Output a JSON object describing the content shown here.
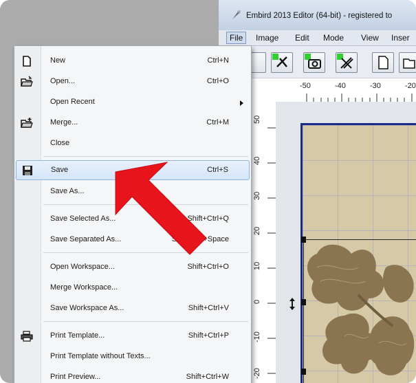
{
  "window": {
    "title": "Embird 2013 Editor (64-bit) - registered to"
  },
  "menubar": {
    "items": [
      "File",
      "Image",
      "Edit",
      "Mode",
      "View",
      "Inser"
    ]
  },
  "ruler": {
    "top_labels": [
      "-50",
      "-40",
      "-30",
      "-20"
    ],
    "left_labels": [
      "50",
      "40",
      "30",
      "20",
      "10",
      "0",
      "-10",
      "-20"
    ]
  },
  "file_menu": {
    "items": [
      {
        "label": "New",
        "shortcut": "Ctrl+N",
        "icon": "new-file-icon"
      },
      {
        "label": "Open...",
        "shortcut": "Ctrl+O",
        "icon": "open-folder-icon"
      },
      {
        "label": "Open Recent",
        "shortcut": "",
        "icon": ""
      },
      {
        "label": "Merge...",
        "shortcut": "Ctrl+M",
        "icon": "merge-folder-icon"
      },
      {
        "label": "Close",
        "shortcut": "",
        "icon": ""
      },
      {
        "label": "Save",
        "shortcut": "Ctrl+S",
        "icon": "floppy-disk-icon"
      },
      {
        "label": "Save As...",
        "shortcut": "",
        "icon": ""
      },
      {
        "label": "Save Selected As...",
        "shortcut": "Shift+Ctrl+Q",
        "icon": ""
      },
      {
        "label": "Save Separated As...",
        "shortcut": "Shift+Ctrl+Space",
        "icon": ""
      },
      {
        "label": "Open Workspace...",
        "shortcut": "Shift+Ctrl+O",
        "icon": ""
      },
      {
        "label": "Merge Workspace...",
        "shortcut": "",
        "icon": ""
      },
      {
        "label": "Save Workspace As...",
        "shortcut": "Shift+Ctrl+V",
        "icon": ""
      },
      {
        "label": "Print Template...",
        "shortcut": "Shift+Ctrl+P",
        "icon": "printer-icon"
      },
      {
        "label": "Print Template without Texts...",
        "shortcut": "",
        "icon": ""
      },
      {
        "label": "Print Preview...",
        "shortcut": "Shift+Ctrl+W",
        "icon": ""
      }
    ]
  },
  "colors": {
    "hoop_border": "#1c2b8a",
    "hoop_fill": "#d6c9a7",
    "highlight": "#d4e5f8",
    "arrow": "#e8141c",
    "design": "#8a7550"
  }
}
